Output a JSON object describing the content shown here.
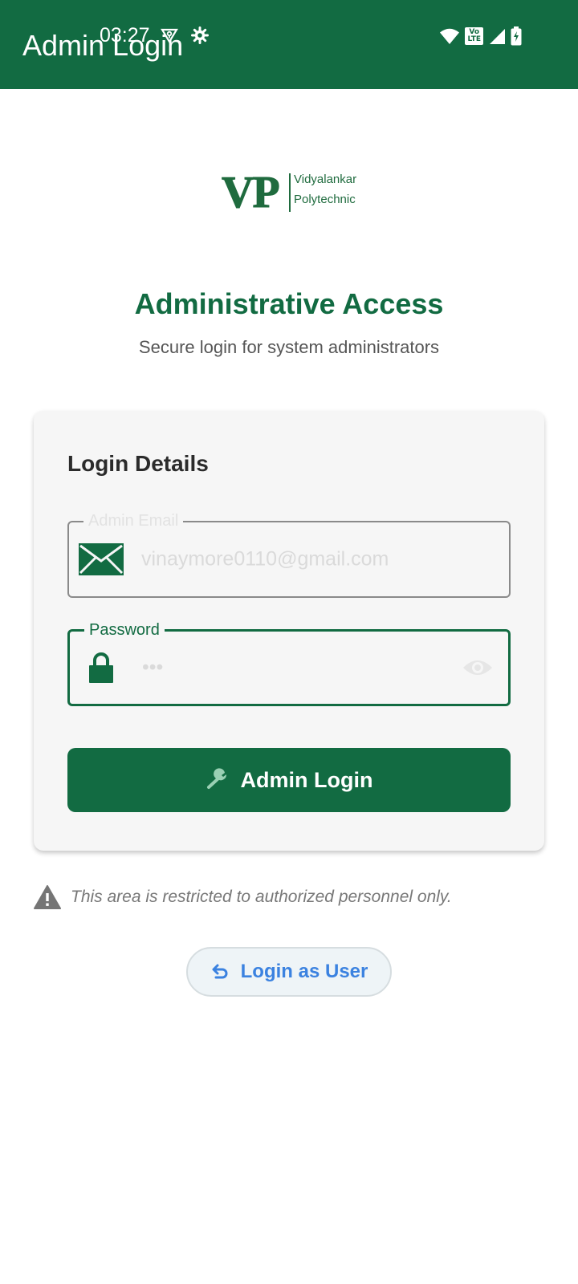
{
  "status_bar": {
    "time": "03:27",
    "icons": [
      "vpn-key-icon",
      "settings-gear-icon",
      "wifi-icon",
      "volte-icon",
      "signal-icon",
      "battery-charging-icon"
    ],
    "volte_top": "Vo",
    "volte_bottom": "LTE"
  },
  "app_bar": {
    "title": "Admin Login",
    "background_color": "#126b42"
  },
  "logo": {
    "mark": "VP",
    "line1": "Vidyalankar",
    "line2": "Polytechnic",
    "color": "#1f6b3e"
  },
  "header": {
    "title": "Administrative Access",
    "subtitle": "Secure login for system administrators"
  },
  "card": {
    "title": "Login Details",
    "email": {
      "label": "Admin Email",
      "value": "vinaymore0110@gmail.com",
      "icon": "envelope-icon"
    },
    "password": {
      "label": "Password",
      "value": "•••",
      "icon": "lock-icon",
      "toggle_icon": "eye-icon"
    },
    "submit": {
      "label": "Admin Login",
      "icon": "wrench-icon"
    }
  },
  "warning": {
    "icon": "warning-icon",
    "text": "This area is restricted to authorized personnel only."
  },
  "switch_login": {
    "label": "Login as User",
    "icon": "undo-arrow-icon"
  },
  "colors": {
    "primary": "#126b42",
    "link_blue": "#3b82e0",
    "card_background": "#f6f6f6"
  }
}
